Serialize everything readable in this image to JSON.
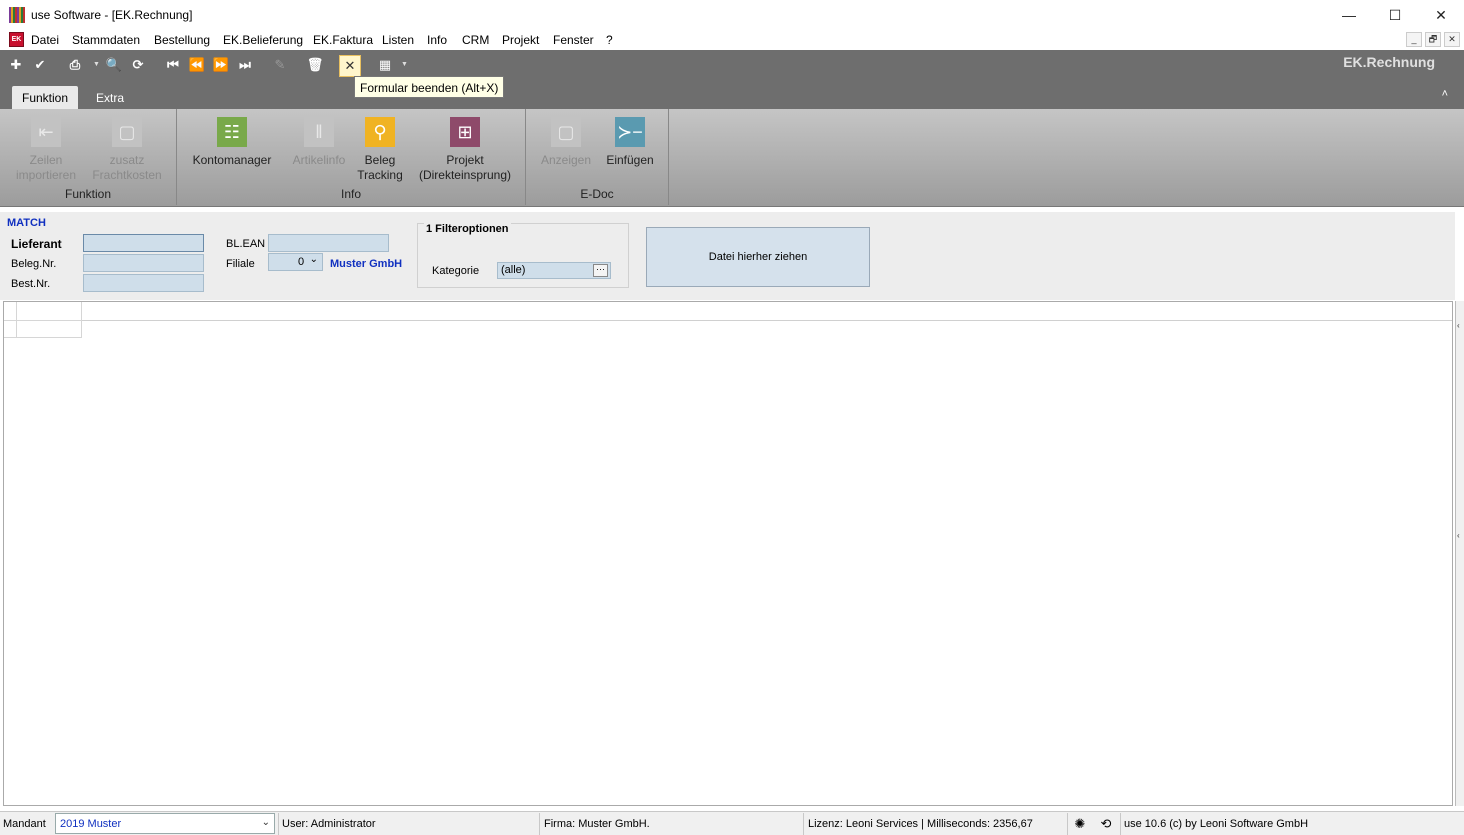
{
  "window": {
    "title": "use Software - [EK.Rechnung]",
    "minimize": "—",
    "maximize": "☐",
    "close": "✕"
  },
  "menu": {
    "icon_text": "EK",
    "items": [
      "Datei",
      "Stammdaten",
      "Bestellung",
      "EK.Belieferung",
      "EK.Faktura",
      "Listen",
      "Info",
      "CRM",
      "Projekt",
      "Fenster",
      "?"
    ],
    "mdi_buttons": [
      "_",
      "🗗",
      "✕"
    ]
  },
  "toolbar": {
    "form_label": "EK.Rechnung",
    "tooltip": "Formular beenden (Alt+X)",
    "buttons": [
      {
        "icon": "plus-icon",
        "glyph": "✚"
      },
      {
        "icon": "check-icon",
        "glyph": "✔"
      },
      {
        "icon": "print-icon",
        "glyph": "⎙"
      },
      {
        "icon": "search-icon",
        "glyph": "🔍"
      },
      {
        "icon": "refresh-icon",
        "glyph": "⟳"
      },
      {
        "icon": "first-record-icon",
        "glyph": "⏮"
      },
      {
        "icon": "previous-record-icon",
        "glyph": "⏪"
      },
      {
        "icon": "next-record-icon",
        "glyph": "⏩"
      },
      {
        "icon": "last-record-icon",
        "glyph": "⏭"
      },
      {
        "icon": "edit-icon",
        "glyph": "✎"
      },
      {
        "icon": "delete-icon",
        "glyph": "🗑"
      },
      {
        "icon": "close-form-icon",
        "glyph": "✕"
      },
      {
        "icon": "grid-icon",
        "glyph": "▦"
      }
    ]
  },
  "tabs": [
    {
      "label": "Funktion",
      "active": true
    },
    {
      "label": "Extra",
      "active": false
    }
  ],
  "collapse_glyph": "˄",
  "ribbon": {
    "groups": [
      {
        "label": "Funktion",
        "buttons": [
          {
            "line1": "Zeilen",
            "line2": "importieren",
            "enabled": false,
            "icon": "import-rows-icon",
            "glyph": "⇤"
          },
          {
            "line1": "zusatz",
            "line2": "Frachtkosten",
            "enabled": false,
            "icon": "freight-cost-icon",
            "glyph": "▢"
          }
        ]
      },
      {
        "label": "Info",
        "buttons": [
          {
            "line1": "Kontomanager",
            "line2": "",
            "enabled": true,
            "icon": "account-manager-icon",
            "glyph": "☷"
          },
          {
            "line1": "Artikelinfo",
            "line2": "",
            "enabled": false,
            "icon": "article-info-icon",
            "glyph": "‖"
          },
          {
            "line1": "Beleg",
            "line2": "Tracking",
            "enabled": true,
            "icon": "document-tracking-icon",
            "glyph": "⚲"
          },
          {
            "line1": "Projekt",
            "line2": "(Direkteinsprung)",
            "enabled": true,
            "icon": "project-icon",
            "glyph": "⊞"
          }
        ]
      },
      {
        "label": "E-Doc",
        "buttons": [
          {
            "line1": "Anzeigen",
            "line2": "",
            "enabled": false,
            "icon": "display-document-icon",
            "glyph": "▢"
          },
          {
            "line1": "Einfügen",
            "line2": "",
            "enabled": true,
            "icon": "insert-document-icon",
            "glyph": "≻−"
          }
        ]
      }
    ]
  },
  "filter": {
    "match_label": "MATCH",
    "lieferant_label": "Lieferant",
    "lieferant_value": "",
    "belegnr_label": "Beleg.Nr.",
    "belegnr_value": "",
    "bestnr_label": "Best.Nr.",
    "bestnr_value": "",
    "blean_label": "BL.EAN",
    "blean_value": "",
    "filiale_label": "Filiale",
    "filiale_value": "0",
    "filiale_name": "Muster GmbH",
    "filteroptionen_legend": "1 Filteroptionen",
    "kategorie_label": "Kategorie",
    "kategorie_value": "(alle)",
    "kategorie_button": "···",
    "dropzone": "Datei hierher ziehen"
  },
  "statusbar": {
    "mandant_label": "Mandant",
    "mandant_value": "2019 Muster",
    "user": "User: Administrator",
    "firma": "Firma: Muster GmbH.",
    "lizenz": "Lizenz: Leoni Services | Milliseconds: 2356,67",
    "version": "use 10.6 (c) by Leoni Software GmbH"
  }
}
